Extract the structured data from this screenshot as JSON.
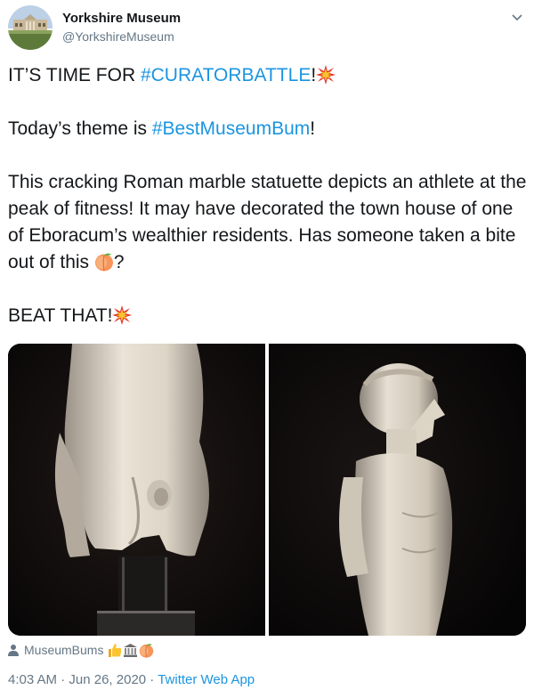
{
  "author": {
    "display_name": "Yorkshire Museum",
    "handle": "@YorkshireMuseum"
  },
  "tweet": {
    "line1_prefix": "IT’S TIME FOR ",
    "line1_hashtag": "#CURATORBATTLE",
    "line1_suffix": "!",
    "line2_prefix": "Today’s theme is ",
    "line2_hashtag": "#BestMuseumBum",
    "line2_suffix": "!",
    "paragraph": "This cracking Roman marble statuette depicts an athlete at the peak of fitness! It may have decorated the town house of one of Eboracum’s wealthier residents. Has someone taken a bite out of this",
    "paragraph_suffix": "?",
    "closing": "BEAT THAT!",
    "emojis": [
      "collision-emoji",
      "peach-emoji"
    ]
  },
  "media": {
    "photos": [
      {
        "subject": "marble statuette rear view"
      },
      {
        "subject": "marble statuette side profile"
      }
    ]
  },
  "tagged": {
    "label": "MuseumBums",
    "emojis": [
      "thumbs-up-emoji",
      "classical-building-emoji",
      "peach-emoji"
    ]
  },
  "meta": {
    "time": "4:03 AM",
    "separator": " · ",
    "date": "Jun 26, 2020",
    "separator2": " · ",
    "source": "Twitter Web App"
  },
  "colors": {
    "link": "#1b95e0",
    "secondary": "#657786",
    "text": "#14171a"
  }
}
